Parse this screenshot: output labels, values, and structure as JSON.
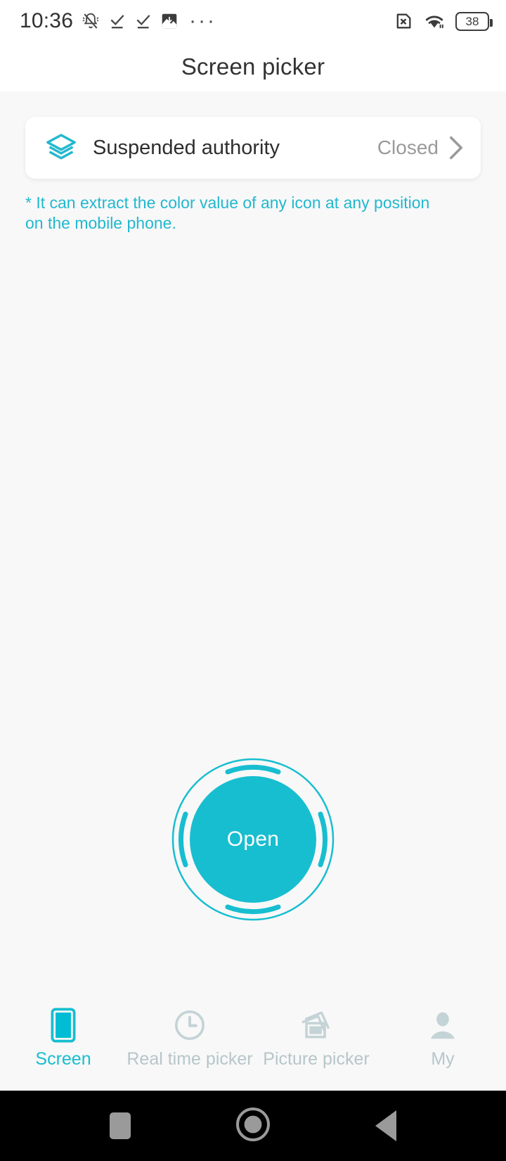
{
  "status_bar": {
    "time": "10:36",
    "battery_level": "38",
    "left_icons": [
      "bell-muted-icon",
      "check-underline-icon",
      "check-underline-icon",
      "image-download-icon",
      "ellipsis-icon"
    ],
    "right_icons": [
      "sim-error-icon",
      "wifi-icon",
      "battery-icon"
    ]
  },
  "header": {
    "title": "Screen picker"
  },
  "permission_card": {
    "icon": "layers-icon",
    "title": "Suspended authority",
    "status": "Closed",
    "chevron": "chevron-right-icon"
  },
  "hint": {
    "text": "* It can extract the color value of any icon at any position on the mobile phone."
  },
  "open_button": {
    "label": "Open"
  },
  "tabs": [
    {
      "label": "Screen",
      "icon": "phone-screen-icon",
      "active": true
    },
    {
      "label": "Real time picker",
      "icon": "clock-icon",
      "active": false
    },
    {
      "label": "Picture picker",
      "icon": "photos-stack-icon",
      "active": false
    },
    {
      "label": "My",
      "icon": "person-icon",
      "active": false
    }
  ],
  "nav_bar": {
    "recents": "square-icon",
    "home": "circle-icon",
    "back": "triangle-back-icon"
  },
  "colors": {
    "accent": "#17bed0",
    "hint_text": "#22b8cf",
    "inactive_tab": "#b7c6c9",
    "page_background": "#f8f8f8"
  }
}
